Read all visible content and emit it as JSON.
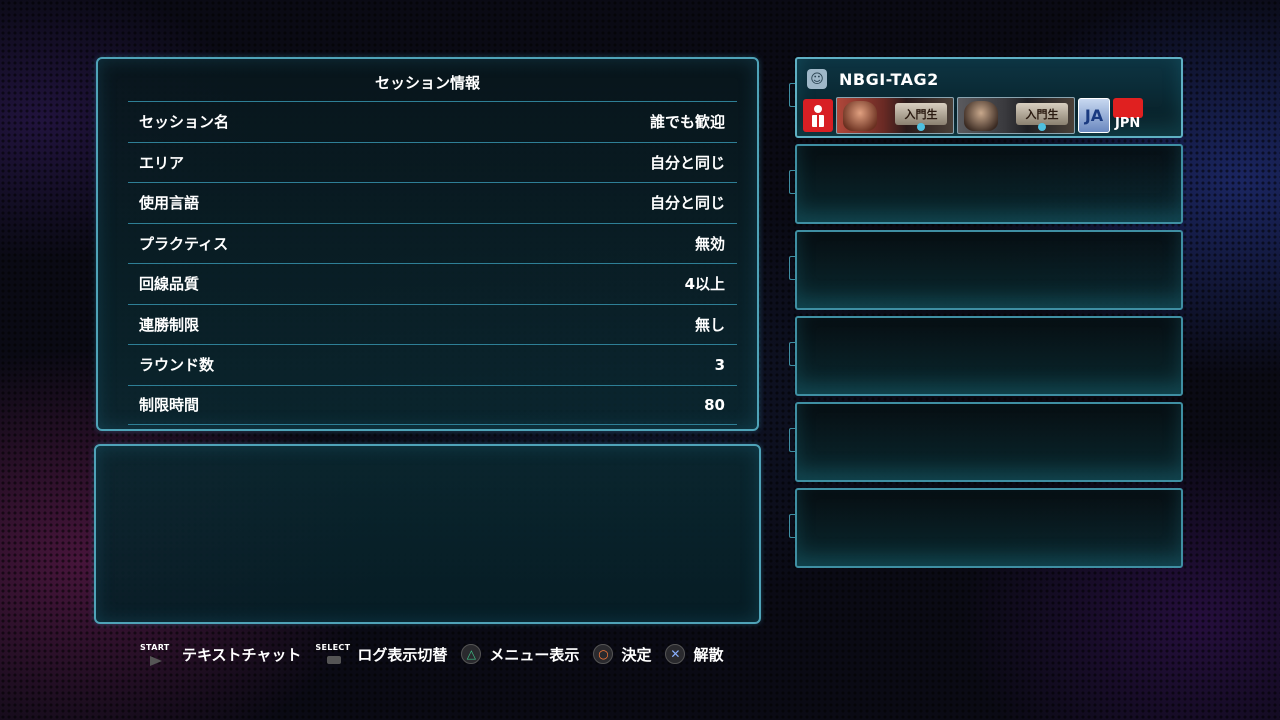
{
  "session_info": {
    "title": "セッション情報",
    "rows": [
      {
        "label": "セッション名",
        "value": "誰でも歓迎"
      },
      {
        "label": "エリア",
        "value": "自分と同じ"
      },
      {
        "label": "使用言語",
        "value": "自分と同じ"
      },
      {
        "label": "プラクティス",
        "value": "無効"
      },
      {
        "label": "回線品質",
        "value": "4以上"
      },
      {
        "label": "連勝制限",
        "value": "無し"
      },
      {
        "label": "ラウンド数",
        "value": "3"
      },
      {
        "label": "制限時間",
        "value": "80"
      }
    ]
  },
  "player": {
    "name": "NBGI-TAG2",
    "status_icon": "face-icon",
    "characters": [
      {
        "rank": "入門生",
        "icon": "character-portrait-1"
      },
      {
        "rank": "入門生",
        "icon": "character-portrait-2"
      }
    ],
    "language": "JA",
    "country": "JPN"
  },
  "empty_slots": 5,
  "footer": {
    "start_cap": "START",
    "start_label": "テキストチャット",
    "select_cap": "SELECT",
    "select_label": "ログ表示切替",
    "triangle_label": "メニュー表示",
    "circle_label": "決定",
    "cross_label": "解散"
  },
  "colors": {
    "panel_border": "#4fa3b8",
    "accent_red": "#d81f24"
  }
}
